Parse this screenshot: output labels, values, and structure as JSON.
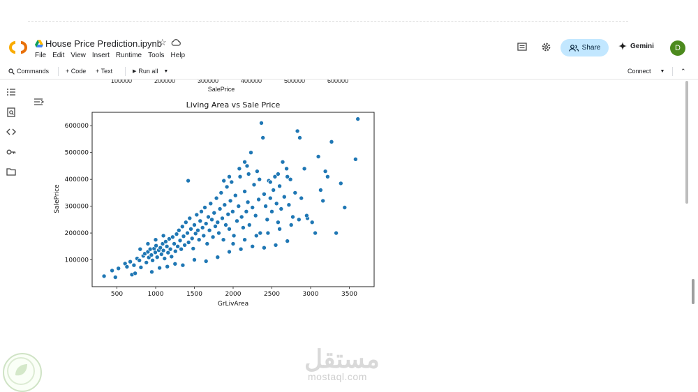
{
  "notebook": {
    "title": "House Price Prediction.ipynb",
    "menu": [
      "File",
      "Edit",
      "View",
      "Insert",
      "Runtime",
      "Tools",
      "Help"
    ]
  },
  "header_right": {
    "share_label": "Share",
    "gemini_label": "Gemini",
    "avatar_letter": "D"
  },
  "toolbar": {
    "commands_label": "Commands",
    "code_label": "+ Code",
    "text_label": "+ Text",
    "run_all_label": "Run all",
    "connect_label": "Connect"
  },
  "previous_plot": {
    "x_ticks": [
      "100000",
      "200000",
      "300000",
      "400000",
      "500000",
      "600000"
    ],
    "xlabel": "SalePrice"
  },
  "watermark": {
    "arabic": "مستقل",
    "url": "mostaql.com"
  },
  "colors": {
    "accent": "#1f77b4",
    "share_bg": "#c2e7ff",
    "avatar_bg": "#4c8a1e"
  },
  "chart_data": {
    "type": "scatter",
    "title": "Living Area vs Sale Price",
    "xlabel": "GrLivArea",
    "ylabel": "SalePrice",
    "xlim": [
      180,
      3820
    ],
    "ylim": [
      0,
      650000
    ],
    "x_ticks": [
      500,
      1000,
      1500,
      2000,
      2500,
      3000,
      3500
    ],
    "y_ticks": [
      100000,
      200000,
      300000,
      400000,
      500000,
      600000
    ],
    "grid": false,
    "dense_region_note": "",
    "points": [
      [
        334,
        39300
      ],
      [
        438,
        60000
      ],
      [
        480,
        35000
      ],
      [
        520,
        68000
      ],
      [
        605,
        86000
      ],
      [
        630,
        74000
      ],
      [
        672,
        93000
      ],
      [
        694,
        45000
      ],
      [
        720,
        80000
      ],
      [
        735,
        50000
      ],
      [
        760,
        105000
      ],
      [
        790,
        98000
      ],
      [
        810,
        72000
      ],
      [
        840,
        115000
      ],
      [
        860,
        123000
      ],
      [
        880,
        90000
      ],
      [
        900,
        130000
      ],
      [
        912,
        109000
      ],
      [
        930,
        140000
      ],
      [
        945,
        118000
      ],
      [
        960,
        98000
      ],
      [
        980,
        142000
      ],
      [
        995,
        128000
      ],
      [
        1005,
        153000
      ],
      [
        1020,
        110000
      ],
      [
        1040,
        136000
      ],
      [
        1060,
        145000
      ],
      [
        1075,
        121000
      ],
      [
        1090,
        160000
      ],
      [
        1100,
        135000
      ],
      [
        1115,
        105000
      ],
      [
        1130,
        168000
      ],
      [
        1145,
        150000
      ],
      [
        1160,
        127000
      ],
      [
        1175,
        178000
      ],
      [
        1190,
        140000
      ],
      [
        1205,
        112000
      ],
      [
        1220,
        185000
      ],
      [
        1240,
        160000
      ],
      [
        1255,
        132000
      ],
      [
        1270,
        196000
      ],
      [
        1285,
        150000
      ],
      [
        1300,
        210000
      ],
      [
        1315,
        172000
      ],
      [
        1330,
        140000
      ],
      [
        1345,
        224000
      ],
      [
        1360,
        188000
      ],
      [
        1375,
        155000
      ],
      [
        1390,
        240000
      ],
      [
        1410,
        200000
      ],
      [
        1425,
        165000
      ],
      [
        1440,
        255000
      ],
      [
        1455,
        215000
      ],
      [
        1470,
        180000
      ],
      [
        1485,
        142000
      ],
      [
        1500,
        230000
      ],
      [
        1515,
        198000
      ],
      [
        1530,
        268000
      ],
      [
        1545,
        210000
      ],
      [
        1560,
        175000
      ],
      [
        1575,
        245000
      ],
      [
        1590,
        280000
      ],
      [
        1605,
        220000
      ],
      [
        1620,
        190000
      ],
      [
        1635,
        295000
      ],
      [
        1650,
        235000
      ],
      [
        1665,
        160000
      ],
      [
        1680,
        260000
      ],
      [
        1695,
        210000
      ],
      [
        1710,
        310000
      ],
      [
        1725,
        250000
      ],
      [
        1740,
        185000
      ],
      [
        1755,
        275000
      ],
      [
        1770,
        225000
      ],
      [
        1785,
        330000
      ],
      [
        1800,
        240000
      ],
      [
        1815,
        200000
      ],
      [
        1830,
        290000
      ],
      [
        1845,
        350000
      ],
      [
        1860,
        255000
      ],
      [
        1875,
        175000
      ],
      [
        1890,
        305000
      ],
      [
        1905,
        230000
      ],
      [
        1920,
        372000
      ],
      [
        1935,
        270000
      ],
      [
        1950,
        215000
      ],
      [
        1965,
        320000
      ],
      [
        1980,
        390000
      ],
      [
        1995,
        280000
      ],
      [
        2010,
        190000
      ],
      [
        2030,
        340000
      ],
      [
        2050,
        245000
      ],
      [
        2070,
        300000
      ],
      [
        2090,
        410000
      ],
      [
        2110,
        260000
      ],
      [
        2130,
        220000
      ],
      [
        2150,
        355000
      ],
      [
        2170,
        280000
      ],
      [
        2190,
        315000
      ],
      [
        2210,
        230000
      ],
      [
        2230,
        500000
      ],
      [
        2250,
        295000
      ],
      [
        2270,
        380000
      ],
      [
        2290,
        265000
      ],
      [
        2310,
        430000
      ],
      [
        2330,
        325000
      ],
      [
        2350,
        200000
      ],
      [
        2365,
        610000
      ],
      [
        2385,
        555000
      ],
      [
        2400,
        345000
      ],
      [
        2420,
        300000
      ],
      [
        2440,
        250000
      ],
      [
        2460,
        395000
      ],
      [
        2480,
        330000
      ],
      [
        2500,
        280000
      ],
      [
        2520,
        360000
      ],
      [
        2540,
        410000
      ],
      [
        2560,
        310000
      ],
      [
        2580,
        240000
      ],
      [
        2600,
        375000
      ],
      [
        2620,
        290000
      ],
      [
        2640,
        465000
      ],
      [
        2660,
        335000
      ],
      [
        2690,
        440000
      ],
      [
        2720,
        305000
      ],
      [
        2740,
        400000
      ],
      [
        2770,
        260000
      ],
      [
        2800,
        350000
      ],
      [
        2830,
        580000
      ],
      [
        2860,
        555000
      ],
      [
        2880,
        330000
      ],
      [
        2920,
        440000
      ],
      [
        2960,
        255000
      ],
      [
        3020,
        240000
      ],
      [
        3060,
        200000
      ],
      [
        3100,
        485000
      ],
      [
        3130,
        360000
      ],
      [
        3160,
        320000
      ],
      [
        3190,
        430000
      ],
      [
        3220,
        410000
      ],
      [
        3270,
        540000
      ],
      [
        3330,
        200000
      ],
      [
        3390,
        385000
      ],
      [
        3440,
        295000
      ],
      [
        3580,
        475000
      ],
      [
        3610,
        625000
      ],
      [
        2150,
        465000
      ],
      [
        2080,
        440000
      ],
      [
        1950,
        410000
      ],
      [
        1880,
        395000
      ],
      [
        1420,
        395000
      ],
      [
        2480,
        390000
      ],
      [
        2580,
        420000
      ],
      [
        2700,
        410000
      ],
      [
        2340,
        400000
      ],
      [
        2180,
        450000
      ],
      [
        2200,
        420000
      ],
      [
        1500,
        100000
      ],
      [
        1650,
        95000
      ],
      [
        1800,
        110000
      ],
      [
        1950,
        130000
      ],
      [
        2100,
        140000
      ],
      [
        2250,
        150000
      ],
      [
        2400,
        145000
      ],
      [
        2550,
        155000
      ],
      [
        2700,
        170000
      ],
      [
        1350,
        80000
      ],
      [
        1250,
        85000
      ],
      [
        1150,
        75000
      ],
      [
        1050,
        70000
      ],
      [
        950,
        55000
      ],
      [
        2000,
        160000
      ],
      [
        2150,
        175000
      ],
      [
        2300,
        190000
      ],
      [
        2450,
        200000
      ],
      [
        2600,
        215000
      ],
      [
        2750,
        230000
      ],
      [
        2850,
        250000
      ],
      [
        2950,
        265000
      ],
      [
        1100,
        190000
      ],
      [
        1000,
        175000
      ],
      [
        900,
        160000
      ],
      [
        800,
        140000
      ]
    ]
  }
}
